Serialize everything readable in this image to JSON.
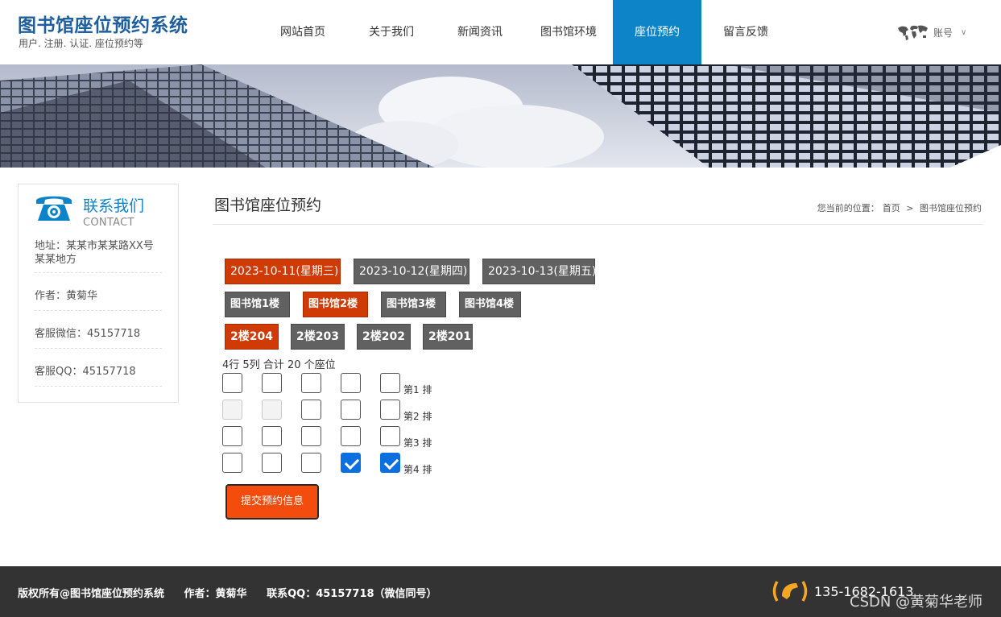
{
  "header": {
    "title": "图书馆座位预约系统",
    "subtitle": "用户. 注册. 认证. 座位预约等",
    "nav": [
      "网站首页",
      "关于我们",
      "新闻资讯",
      "图书馆环境",
      "座位预约",
      "留言反馈"
    ],
    "active_nav": "座位预约",
    "account_label": "账号"
  },
  "sidebar": {
    "contact_title": "联系我们",
    "contact_en": "CONTACT",
    "address": "地址：某某市某某路XX号某某地方",
    "author": "作者：黄菊华",
    "wechat": "客服微信：45157718",
    "qq": "客服QQ：45157718"
  },
  "main": {
    "title": "图书馆座位预约",
    "breadcrumb_prefix": "您当前的位置：",
    "breadcrumb_home": "首页",
    "breadcrumb_sep": ">",
    "breadcrumb_current": "图书馆座位预约",
    "dates": [
      "2023-10-11(星期三)",
      "2023-10-12(星期四)",
      "2023-10-13(星期五)"
    ],
    "selected_date": "2023-10-11(星期三)",
    "floors": [
      "图书馆1楼",
      "图书馆2楼",
      "图书馆3楼",
      "图书馆4楼"
    ],
    "selected_floor": "图书馆2楼",
    "rooms": [
      "2楼204",
      "2楼203",
      "2楼202",
      "2楼201"
    ],
    "selected_room": "2楼204",
    "seat_summary": "4行 5列 合计 20 个座位",
    "row_labels": [
      "第1 排",
      "第2 排",
      "第3 排",
      "第4 排"
    ],
    "seats": [
      [
        "empty",
        "empty",
        "empty",
        "empty",
        "empty"
      ],
      [
        "disabled",
        "disabled",
        "empty",
        "empty",
        "empty"
      ],
      [
        "empty",
        "empty",
        "empty",
        "empty",
        "empty"
      ],
      [
        "empty",
        "empty",
        "empty",
        "checked",
        "checked"
      ]
    ],
    "submit_label": "提交预约信息"
  },
  "footer": {
    "copyright": "版权所有@图书馆座位预约系统",
    "author": "作者：黄菊华",
    "contact_qq": "联系QQ：45157718（微信同号）",
    "phone": "135-1682-1613",
    "watermark": "CSDN @黄菊华老师"
  },
  "colors": {
    "brand_blue": "#0d84c8",
    "selected_chip": "#cf3a05",
    "chip_gray": "#616161",
    "submit": "#f44c0c",
    "footer_bg": "#333333",
    "phone_orange": "#f5a623"
  },
  "icons": {
    "account": "world-map-icon",
    "contact": "telephone-icon",
    "footer_phone": "phone-handset-icon"
  }
}
